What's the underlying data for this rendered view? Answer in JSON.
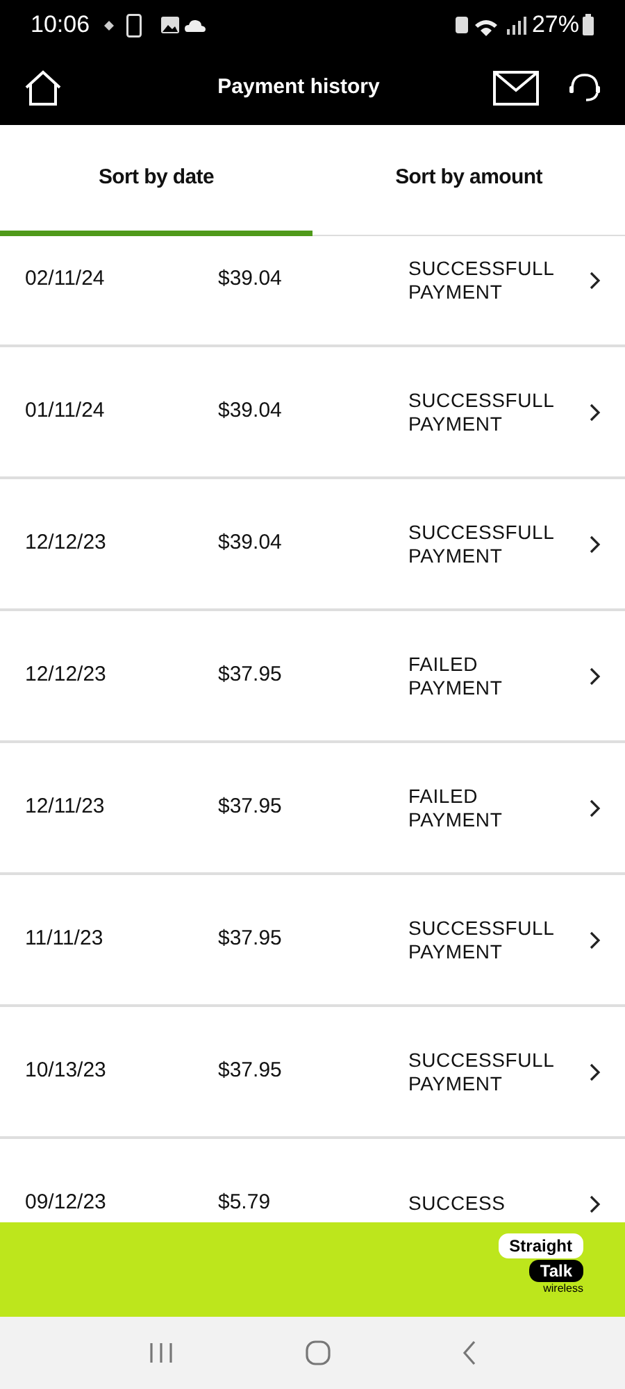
{
  "status_bar": {
    "time": "10:06",
    "battery": "27%"
  },
  "header": {
    "title": "Payment history"
  },
  "tabs": [
    {
      "label": "Sort by date",
      "selected": true
    },
    {
      "label": "Sort by amount",
      "selected": false
    }
  ],
  "payments": [
    {
      "date": "02/11/24",
      "amount": "$39.04",
      "status": "SUCCESSFULL PAYMENT"
    },
    {
      "date": "01/11/24",
      "amount": "$39.04",
      "status": "SUCCESSFULL PAYMENT"
    },
    {
      "date": "12/12/23",
      "amount": "$39.04",
      "status": "SUCCESSFULL PAYMENT"
    },
    {
      "date": "12/12/23",
      "amount": "$37.95",
      "status": "FAILED PAYMENT"
    },
    {
      "date": "12/11/23",
      "amount": "$37.95",
      "status": "FAILED PAYMENT"
    },
    {
      "date": "11/11/23",
      "amount": "$37.95",
      "status": "SUCCESSFULL PAYMENT"
    },
    {
      "date": "10/13/23",
      "amount": "$37.95",
      "status": "SUCCESSFULL PAYMENT"
    },
    {
      "date": "09/12/23",
      "amount": "$5.79",
      "status": "SUCCESS"
    }
  ],
  "banner": {
    "logo_top": "Straight",
    "logo_bottom": "Talk",
    "logo_sub": "wireless"
  }
}
